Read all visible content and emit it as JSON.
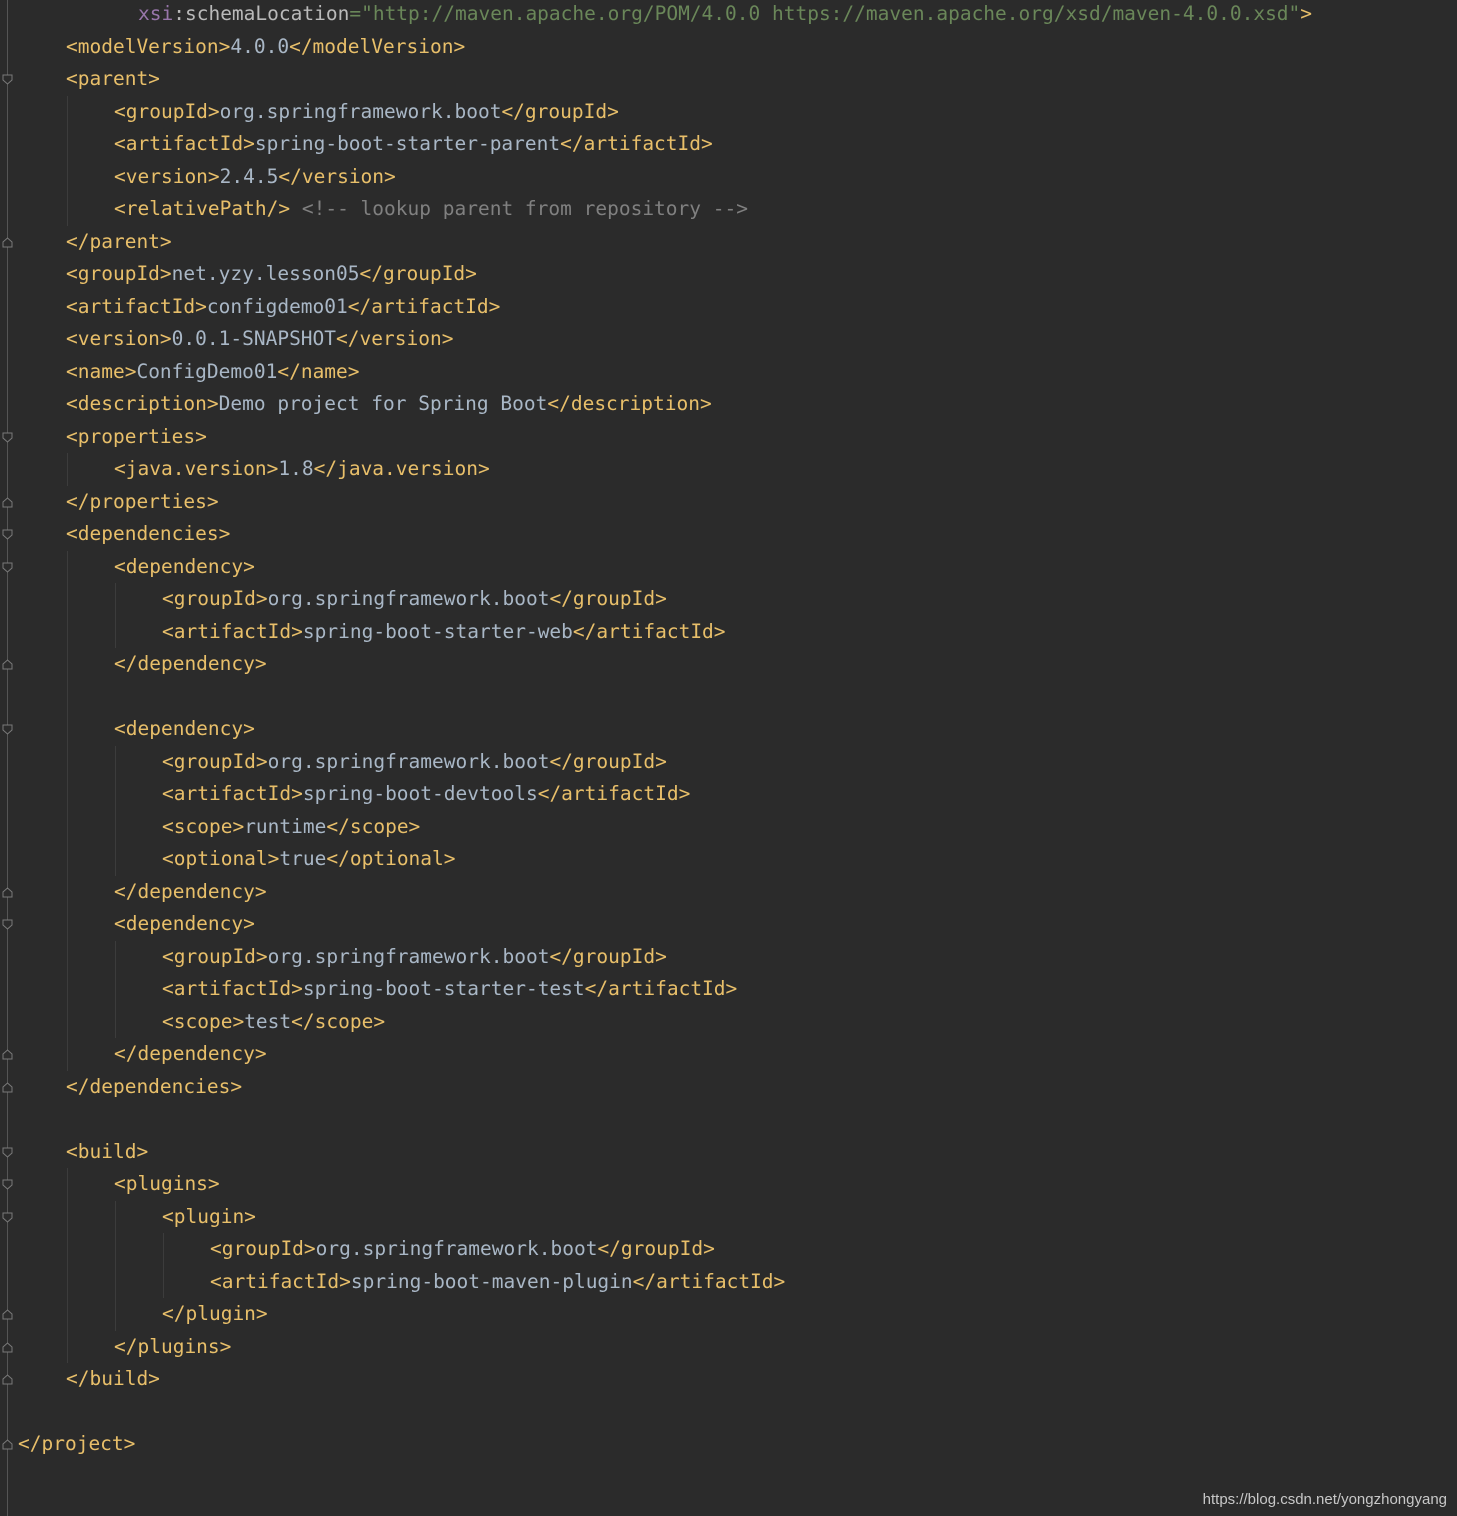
{
  "editor": {
    "language": "xml",
    "colors": {
      "background": "#2b2b2b",
      "tag": "#e8bf6a",
      "text": "#a9b7c6",
      "string": "#6a8759",
      "comment": "#808080",
      "attribute": "#bababa",
      "namespace": "#9876aa"
    },
    "lines": [
      {
        "indent": 5,
        "tokens": [
          [
            "attr-ns",
            "xsi"
          ],
          [
            "attr",
            ":schemaLocation"
          ],
          [
            "str",
            "=\"http://maven.apache.org/POM/4.0.0 https://maven.apache.org/xsd/maven-4.0.0.xsd\""
          ],
          [
            "tag",
            ">"
          ]
        ]
      },
      {
        "indent": 2,
        "tokens": [
          [
            "tag",
            "<modelVersion>"
          ],
          [
            "txt",
            "4.0.0"
          ],
          [
            "tag",
            "</modelVersion>"
          ]
        ]
      },
      {
        "indent": 2,
        "fold": "open",
        "tokens": [
          [
            "tag",
            "<parent>"
          ]
        ]
      },
      {
        "indent": 4,
        "tokens": [
          [
            "tag",
            "<groupId>"
          ],
          [
            "txt",
            "org.springframework.boot"
          ],
          [
            "tag",
            "</groupId>"
          ]
        ]
      },
      {
        "indent": 4,
        "tokens": [
          [
            "tag",
            "<artifactId>"
          ],
          [
            "txt",
            "spring-boot-starter-parent"
          ],
          [
            "tag",
            "</artifactId>"
          ]
        ]
      },
      {
        "indent": 4,
        "tokens": [
          [
            "tag",
            "<version>"
          ],
          [
            "txt",
            "2.4.5"
          ],
          [
            "tag",
            "</version>"
          ]
        ]
      },
      {
        "indent": 4,
        "tokens": [
          [
            "tag",
            "<relativePath/>"
          ],
          [
            "txt",
            " "
          ],
          [
            "comment",
            "<!-- lookup parent from repository -->"
          ]
        ]
      },
      {
        "indent": 2,
        "fold": "close",
        "tokens": [
          [
            "tag",
            "</parent>"
          ]
        ]
      },
      {
        "indent": 2,
        "tokens": [
          [
            "tag",
            "<groupId>"
          ],
          [
            "txt",
            "net.yzy.lesson05"
          ],
          [
            "tag",
            "</groupId>"
          ]
        ]
      },
      {
        "indent": 2,
        "tokens": [
          [
            "tag",
            "<artifactId>"
          ],
          [
            "txt",
            "configdemo01"
          ],
          [
            "tag",
            "</artifactId>"
          ]
        ]
      },
      {
        "indent": 2,
        "tokens": [
          [
            "tag",
            "<version>"
          ],
          [
            "txt",
            "0.0.1-SNAPSHOT"
          ],
          [
            "tag",
            "</version>"
          ]
        ]
      },
      {
        "indent": 2,
        "tokens": [
          [
            "tag",
            "<name>"
          ],
          [
            "txt",
            "ConfigDemo01"
          ],
          [
            "tag",
            "</name>"
          ]
        ]
      },
      {
        "indent": 2,
        "tokens": [
          [
            "tag",
            "<description>"
          ],
          [
            "txt",
            "Demo project for Spring Boot"
          ],
          [
            "tag",
            "</description>"
          ]
        ]
      },
      {
        "indent": 2,
        "fold": "open",
        "tokens": [
          [
            "tag",
            "<properties>"
          ]
        ]
      },
      {
        "indent": 4,
        "tokens": [
          [
            "tag",
            "<java.version>"
          ],
          [
            "txt",
            "1.8"
          ],
          [
            "tag",
            "</java.version>"
          ]
        ]
      },
      {
        "indent": 2,
        "fold": "close",
        "tokens": [
          [
            "tag",
            "</properties>"
          ]
        ]
      },
      {
        "indent": 2,
        "fold": "open",
        "tokens": [
          [
            "tag",
            "<dependencies>"
          ]
        ]
      },
      {
        "indent": 4,
        "fold": "open",
        "tokens": [
          [
            "tag",
            "<dependency>"
          ]
        ]
      },
      {
        "indent": 6,
        "tokens": [
          [
            "tag",
            "<groupId>"
          ],
          [
            "txt",
            "org.springframework.boot"
          ],
          [
            "tag",
            "</groupId>"
          ]
        ]
      },
      {
        "indent": 6,
        "tokens": [
          [
            "tag",
            "<artifactId>"
          ],
          [
            "txt",
            "spring-boot-starter-web"
          ],
          [
            "tag",
            "</artifactId>"
          ]
        ]
      },
      {
        "indent": 4,
        "fold": "close",
        "tokens": [
          [
            "tag",
            "</dependency>"
          ]
        ]
      },
      {
        "indent": 0,
        "tokens": []
      },
      {
        "indent": 4,
        "fold": "open",
        "tokens": [
          [
            "tag",
            "<dependency>"
          ]
        ]
      },
      {
        "indent": 6,
        "tokens": [
          [
            "tag",
            "<groupId>"
          ],
          [
            "txt",
            "org.springframework.boot"
          ],
          [
            "tag",
            "</groupId>"
          ]
        ]
      },
      {
        "indent": 6,
        "tokens": [
          [
            "tag",
            "<artifactId>"
          ],
          [
            "txt",
            "spring-boot-devtools"
          ],
          [
            "tag",
            "</artifactId>"
          ]
        ]
      },
      {
        "indent": 6,
        "tokens": [
          [
            "tag",
            "<scope>"
          ],
          [
            "txt",
            "runtime"
          ],
          [
            "tag",
            "</scope>"
          ]
        ]
      },
      {
        "indent": 6,
        "tokens": [
          [
            "tag",
            "<optional>"
          ],
          [
            "txt",
            "true"
          ],
          [
            "tag",
            "</optional>"
          ]
        ]
      },
      {
        "indent": 4,
        "fold": "close",
        "tokens": [
          [
            "tag",
            "</dependency>"
          ]
        ]
      },
      {
        "indent": 4,
        "fold": "open",
        "tokens": [
          [
            "tag",
            "<dependency>"
          ]
        ]
      },
      {
        "indent": 6,
        "tokens": [
          [
            "tag",
            "<groupId>"
          ],
          [
            "txt",
            "org.springframework.boot"
          ],
          [
            "tag",
            "</groupId>"
          ]
        ]
      },
      {
        "indent": 6,
        "tokens": [
          [
            "tag",
            "<artifactId>"
          ],
          [
            "txt",
            "spring-boot-starter-test"
          ],
          [
            "tag",
            "</artifactId>"
          ]
        ]
      },
      {
        "indent": 6,
        "tokens": [
          [
            "tag",
            "<scope>"
          ],
          [
            "txt",
            "test"
          ],
          [
            "tag",
            "</scope>"
          ]
        ]
      },
      {
        "indent": 4,
        "fold": "close",
        "tokens": [
          [
            "tag",
            "</dependency>"
          ]
        ]
      },
      {
        "indent": 2,
        "fold": "close",
        "tokens": [
          [
            "tag",
            "</dependencies>"
          ]
        ]
      },
      {
        "indent": 0,
        "tokens": []
      },
      {
        "indent": 2,
        "fold": "open",
        "tokens": [
          [
            "tag",
            "<build>"
          ]
        ]
      },
      {
        "indent": 4,
        "fold": "open",
        "tokens": [
          [
            "tag",
            "<plugins>"
          ]
        ]
      },
      {
        "indent": 6,
        "fold": "open",
        "tokens": [
          [
            "tag",
            "<plugin>"
          ]
        ]
      },
      {
        "indent": 8,
        "tokens": [
          [
            "tag",
            "<groupId>"
          ],
          [
            "txt",
            "org.springframework.boot"
          ],
          [
            "tag",
            "</groupId>"
          ]
        ]
      },
      {
        "indent": 8,
        "tokens": [
          [
            "tag",
            "<artifactId>"
          ],
          [
            "txt",
            "spring-boot-maven-plugin"
          ],
          [
            "tag",
            "</artifactId>"
          ]
        ]
      },
      {
        "indent": 6,
        "fold": "close",
        "tokens": [
          [
            "tag",
            "</plugin>"
          ]
        ]
      },
      {
        "indent": 4,
        "fold": "close",
        "tokens": [
          [
            "tag",
            "</plugins>"
          ]
        ]
      },
      {
        "indent": 2,
        "fold": "close",
        "tokens": [
          [
            "tag",
            "</build>"
          ]
        ]
      },
      {
        "indent": 0,
        "tokens": []
      },
      {
        "indent": 0,
        "fold": "close",
        "tokens": [
          [
            "tag",
            "</project>"
          ]
        ]
      }
    ]
  },
  "watermark": "https://blog.csdn.net/yongzhongyang"
}
